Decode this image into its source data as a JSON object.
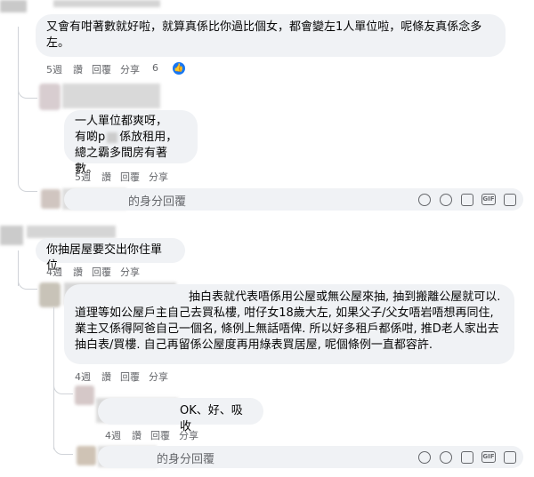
{
  "comments": [
    {
      "text_line1": "又會有咁著數就好啦，就算真係比你過比個女，都會變左1人單位啦，呢條友真係念多",
      "text_line2": "左。",
      "time": "5週",
      "like": "讚",
      "reply": "回覆",
      "share": "分享",
      "reaction_count": "6"
    },
    {
      "text_line1": "一人單位都爽呀，",
      "text_line2": "有啲p",
      "text_line2b": "係放租用，",
      "text_line3": "總之霸多間房有著數。",
      "time": "5週",
      "like": "讚",
      "reply": "回覆",
      "share": "分享"
    },
    {
      "text": "你抽居屋要交出你住單位.",
      "time": "4週",
      "like": "讚",
      "reply": "回覆",
      "share": "分享"
    },
    {
      "text_line1": "抽白表就代表唔係用公屋或無公屋來抽, 抽到搬離公屋就可以.",
      "text_line2": "道理等如公屋戶主自己去買私樓, 咁仔女18歲大左, 如果父子/父女唔岩唔想再同住,",
      "text_line3": "業主又係得阿爸自己一個名, 條例上無話唔俾. 所以好多租戶都係咁, 推D老人家出去",
      "text_line4": "抽白表/買樓. 自己再留係公屋度再用綠表買居屋, 呢個條例一直都容許.",
      "time": "4週",
      "like": "讚",
      "reply": "回覆",
      "share": "分享"
    },
    {
      "text": "OK、好、吸收",
      "time": "4週",
      "like": "讚",
      "reply": "回覆",
      "share": "分享"
    }
  ],
  "reply_boxes": [
    {
      "placeholder": "的身分回覆"
    },
    {
      "placeholder": "的身分回覆"
    }
  ],
  "icons": [
    "emoji-icon",
    "smiley-icon",
    "camera-icon",
    "gif-icon",
    "sticker-icon"
  ],
  "colors": {
    "bubble": "#f0f2f5",
    "meta": "#65676b",
    "like_blue": "#1877f2"
  }
}
